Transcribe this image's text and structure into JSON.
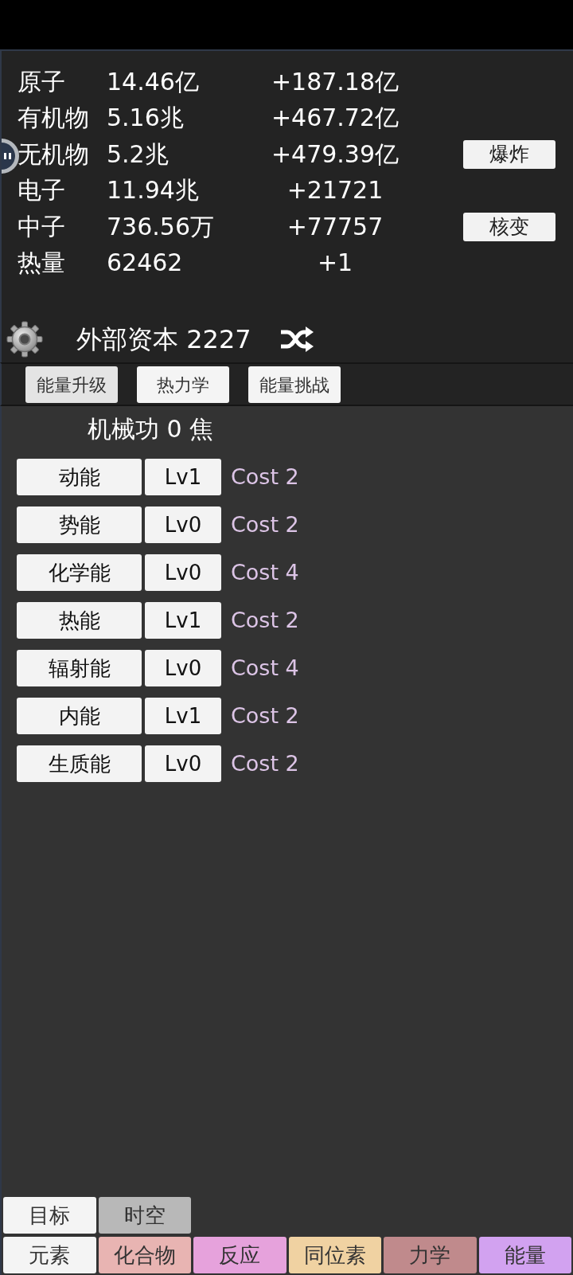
{
  "resources": [
    {
      "name": "原子",
      "amount": "14.46亿",
      "rate": "+187.18亿"
    },
    {
      "name": "有机物",
      "amount": "5.16兆",
      "rate": "+467.72亿"
    },
    {
      "name": "无机物",
      "amount": "5.2兆",
      "rate": "+479.39亿",
      "action": "爆炸"
    },
    {
      "name": "电子",
      "amount": "11.94兆",
      "rate": "+21721"
    },
    {
      "name": "中子",
      "amount": "736.56万",
      "rate": "+77757",
      "action": "核变"
    },
    {
      "name": "热量",
      "amount": "62462",
      "rate": "+1"
    }
  ],
  "capital": "外部资本 2227",
  "subtabs": [
    {
      "label": "能量升级",
      "selected": true
    },
    {
      "label": "热力学",
      "selected": false
    },
    {
      "label": "能量挑战",
      "selected": false
    }
  ],
  "work_total": "机械功 0 焦",
  "upgrades": [
    {
      "name": "动能",
      "tier": "Lv1",
      "cost": "Cost 2"
    },
    {
      "name": "势能",
      "tier": "Lv0",
      "cost": "Cost 2"
    },
    {
      "name": "化学能",
      "tier": "Lv0",
      "cost": "Cost 4"
    },
    {
      "name": "热能",
      "tier": "Lv1",
      "cost": "Cost 2"
    },
    {
      "name": "辐射能",
      "tier": "Lv0",
      "cost": "Cost 4"
    },
    {
      "name": "内能",
      "tier": "Lv1",
      "cost": "Cost 2"
    },
    {
      "name": "生质能",
      "tier": "Lv0",
      "cost": "Cost 2"
    }
  ],
  "upper_tabs": [
    {
      "label": "目标",
      "color": "#f4f4f4"
    },
    {
      "label": "时空",
      "color": "#b8b8b8"
    }
  ],
  "category_tabs": [
    {
      "label": "元素",
      "color": "#f4f4f4"
    },
    {
      "label": "化合物",
      "color": "#e8b4b2"
    },
    {
      "label": "反应",
      "color": "#e6a2dc"
    },
    {
      "label": "同位素",
      "color": "#f0d2a2"
    },
    {
      "label": "力学",
      "color": "#c08a8c"
    },
    {
      "label": "能量",
      "color": "#d2a2f0"
    }
  ]
}
